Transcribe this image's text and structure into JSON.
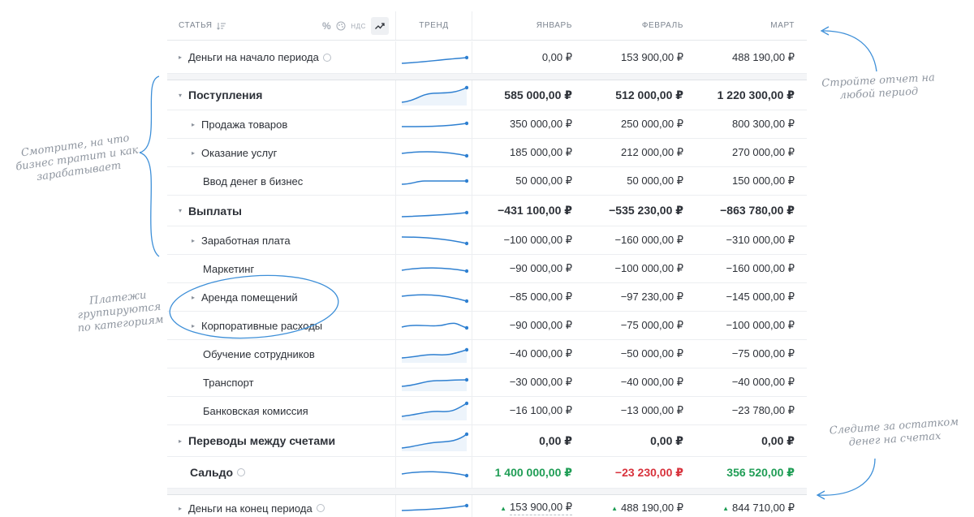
{
  "header": {
    "col_article": "СТАТЬЯ",
    "tool_percent": "%",
    "tool_vat": "НДС",
    "col_trend": "ТРЕНД",
    "months": [
      "ЯНВАРЬ",
      "ФЕВРАЛЬ",
      "МАРТ"
    ]
  },
  "rows": [
    {
      "label": "Деньги на начало периода",
      "values": [
        "0,00 ₽",
        "153 900,00 ₽",
        "488 190,00 ₽"
      ]
    },
    {
      "label": "Поступления",
      "values": [
        "585 000,00 ₽",
        "512 000,00 ₽",
        "1 220 300,00 ₽"
      ]
    },
    {
      "label": "Продажа товаров",
      "values": [
        "350 000,00 ₽",
        "250 000,00 ₽",
        "800 300,00 ₽"
      ]
    },
    {
      "label": "Оказание услуг",
      "values": [
        "185 000,00 ₽",
        "212 000,00 ₽",
        "270 000,00 ₽"
      ]
    },
    {
      "label": "Ввод денег в бизнес",
      "values": [
        "50 000,00 ₽",
        "50 000,00 ₽",
        "150 000,00 ₽"
      ]
    },
    {
      "label": "Выплаты",
      "values": [
        "−431 100,00 ₽",
        "−535 230,00 ₽",
        "−863 780,00 ₽"
      ]
    },
    {
      "label": "Заработная плата",
      "values": [
        "−100 000,00 ₽",
        "−160 000,00 ₽",
        "−310 000,00 ₽"
      ]
    },
    {
      "label": "Маркетинг",
      "values": [
        "−90 000,00 ₽",
        "−100 000,00 ₽",
        "−160 000,00 ₽"
      ]
    },
    {
      "label": "Аренда помещений",
      "values": [
        "−85 000,00 ₽",
        "−97 230,00 ₽",
        "−145 000,00 ₽"
      ]
    },
    {
      "label": "Корпоративные расходы",
      "values": [
        "−90 000,00 ₽",
        "−75 000,00 ₽",
        "−100 000,00 ₽"
      ]
    },
    {
      "label": "Обучение сотрудников",
      "values": [
        "−40 000,00 ₽",
        "−50 000,00 ₽",
        "−75 000,00 ₽"
      ]
    },
    {
      "label": "Транспорт",
      "values": [
        "−30 000,00 ₽",
        "−40 000,00 ₽",
        "−40 000,00 ₽"
      ]
    },
    {
      "label": "Банковская комиссия",
      "values": [
        "−16 100,00 ₽",
        "−13 000,00 ₽",
        "−23 780,00 ₽"
      ]
    },
    {
      "label": "Переводы между счетами",
      "values": [
        "0,00 ₽",
        "0,00 ₽",
        "0,00 ₽"
      ]
    },
    {
      "label": "Сальдо",
      "values": [
        "1 400 000,00 ₽",
        "−23 230,00 ₽",
        "356 520,00 ₽"
      ]
    },
    {
      "label": "Деньги на конец периода",
      "values": [
        "153 900,00 ₽",
        "488 190,00 ₽",
        "844 710,00 ₽"
      ]
    }
  ],
  "annotations": {
    "period": "Стройте отчет на любой период",
    "spending": "Смотрите, на что бизнес тратит и как зарабатывает",
    "categories": "Платежи группируются по категориям",
    "balance": "Следите за остатком денег на счетах"
  },
  "colors": {
    "positive": "#1f9d55",
    "negative": "#d8323c",
    "trend_line": "#2f80d1"
  }
}
